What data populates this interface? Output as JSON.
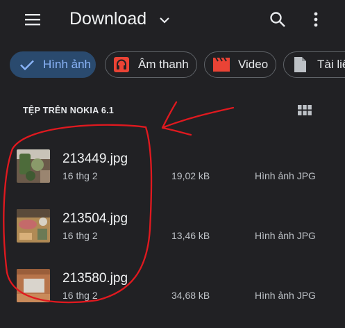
{
  "header": {
    "title": "Download"
  },
  "chips": [
    {
      "label": "Hình ảnh",
      "icon": "check-icon",
      "selected": true
    },
    {
      "label": "Âm thanh",
      "icon": "headphones-icon",
      "selected": false
    },
    {
      "label": "Video",
      "icon": "clapperboard-icon",
      "selected": false
    },
    {
      "label": "Tài liệ",
      "icon": "document-icon",
      "selected": false
    }
  ],
  "section": {
    "label": "TỆP TRÊN NOKIA 6.1"
  },
  "files": [
    {
      "name": "213449.jpg",
      "date": "16 thg 2",
      "size": "19,02 kB",
      "type": "Hình ảnh JPG"
    },
    {
      "name": "213504.jpg",
      "date": "16 thg 2",
      "size": "13,46 kB",
      "type": "Hình ảnh JPG"
    },
    {
      "name": "213580.jpg",
      "date": "16 thg 2",
      "size": "34,68 kB",
      "type": "Hình ảnh JPG"
    }
  ],
  "colors": {
    "background": "#212124",
    "selected_chip": "#2a4a6e",
    "accent": "#8ab4f8",
    "annotation": "#e0191f"
  }
}
